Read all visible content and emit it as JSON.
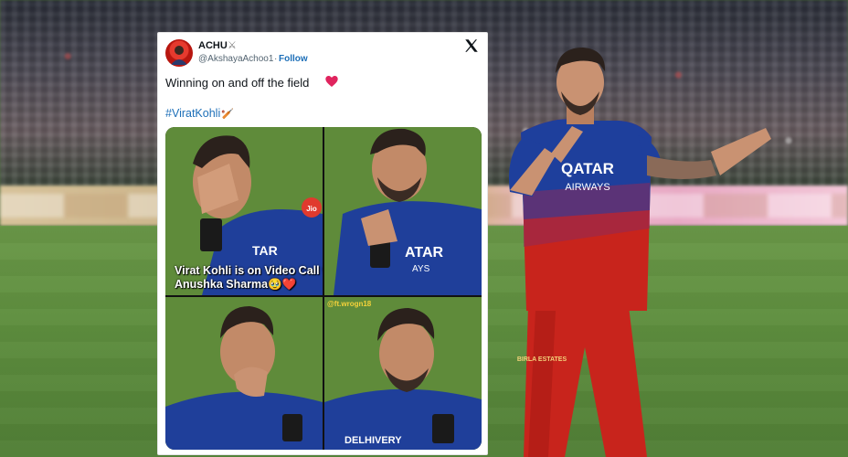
{
  "tweet": {
    "author_name": "ACHU",
    "author_badge": "⚔",
    "author_handle": "@AkshayaAchoo1",
    "separator": "·",
    "follow_label": "Follow",
    "text": "Winning on and off the field",
    "hashtag": "#ViratKohli",
    "hashtag_icon": "🏏",
    "icons": [
      "x-logo-icon",
      "red-heart-icon"
    ],
    "media": {
      "caption": "Virat Kohli is on Video Call with Anushka Sharma🥹❤️",
      "watermark": "@ft.wrogn18",
      "jersey_text": [
        "Jio",
        "QATAR AIRWAYS",
        "DELHIVERY"
      ]
    }
  },
  "player": {
    "jersey_sponsor_line1": "QATAR",
    "jersey_sponsor_line2": "AIRWAYS",
    "trouser_logo": "BIRLA ESTATES"
  },
  "colors": {
    "link_blue": "#1d6fb8",
    "heart_red": "#e0245e",
    "jersey_blue": "#1e3f9c",
    "jersey_red": "#c8241c",
    "pitch_green": "#5f8f3f"
  }
}
